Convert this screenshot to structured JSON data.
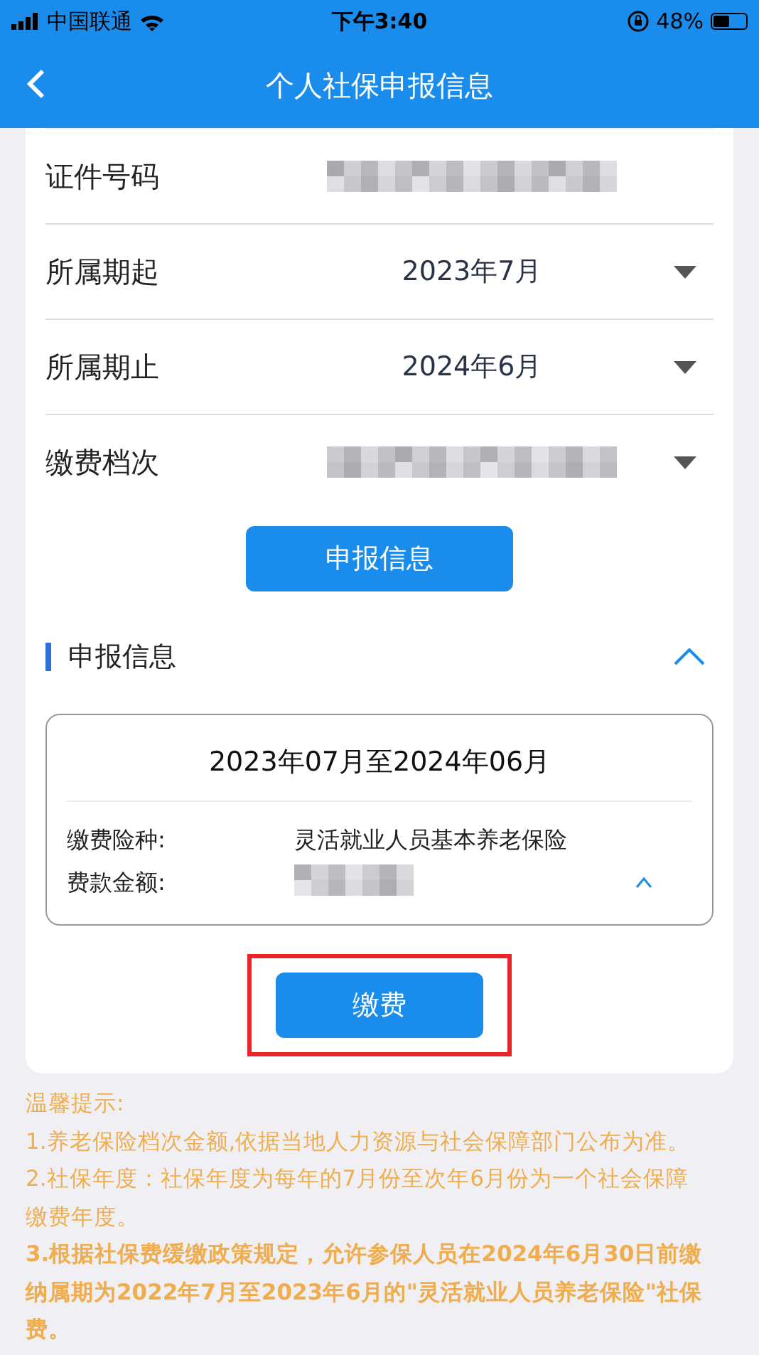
{
  "status_bar": {
    "carrier": "中国联通",
    "time": "下午3:40",
    "battery": "48%"
  },
  "nav": {
    "title": "个人社保申报信息"
  },
  "form": {
    "rows": [
      {
        "label": "证件号码",
        "kind": "text",
        "redacted": true
      },
      {
        "label": "所属期起",
        "kind": "select",
        "value": "2023年7月"
      },
      {
        "label": "所属期止",
        "kind": "select",
        "value": "2024年6月"
      },
      {
        "label": "缴费档次",
        "kind": "select",
        "redacted": true
      }
    ],
    "submit_button": "申报信息"
  },
  "section": {
    "title": "申报信息",
    "expanded": true,
    "record": {
      "period": "2023年07月至2024年06月",
      "expanded": true,
      "fields": [
        {
          "label": "缴费险种:",
          "value": "灵活就业人员基本养老保险"
        },
        {
          "label": "费款金额:",
          "redacted": true
        }
      ]
    },
    "pay_button": {
      "label": "缴费",
      "highlighted": true
    }
  },
  "tips": [
    {
      "text": "温馨提示:",
      "emphasis": false
    },
    {
      "text": "1.养老保险档次金额,依据当地人力资源与社会保障部门公布为准。",
      "emphasis": false
    },
    {
      "text": "2.社保年度：社保年度为每年的7月份至次年6月份为一个社会保障缴费年度。",
      "emphasis": false
    },
    {
      "text": "3.根据社保费缓缴政策规定，允许参保人员在2024年6月30日前缴纳属期为2022年7月至2023年6月的\"灵活就业人员养老保险\"社保费。",
      "emphasis": true
    }
  ]
}
